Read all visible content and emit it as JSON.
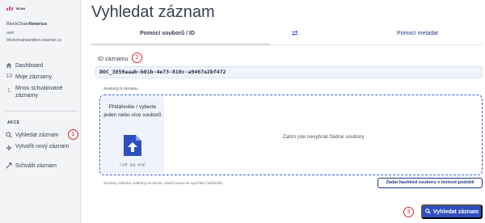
{
  "brand": {
    "logo_text": "BChN",
    "app_name_prefix": "BlockChain",
    "app_name_bold": "Notarius",
    "pink": "#ec4899"
  },
  "user": {
    "role": "uzel",
    "host": "blockchainsandbox.elachan.cz"
  },
  "sidebar": {
    "items": [
      {
        "icon": "home-icon",
        "prefix": "",
        "label": "Dashboard"
      },
      {
        "icon": "count",
        "prefix": "13",
        "label": "Moje záznamy"
      },
      {
        "icon": "count",
        "prefix": "1",
        "label": "Mnou schvalované záznamy"
      }
    ],
    "section_title": "AKCE",
    "actions": [
      {
        "icon": "search-icon",
        "label": "Vyhledat záznam",
        "marker": "1"
      },
      {
        "icon": "plus-icon",
        "label": "Vytvořit nový záznam"
      },
      {
        "icon": "hammer-icon",
        "label": "Schválit záznam"
      }
    ]
  },
  "main": {
    "title": "Vyhledat záznam",
    "tabs": [
      {
        "label": "Pomocí souborů / ID",
        "active": true
      },
      {
        "label": "Pomocí metadat",
        "active": false
      }
    ],
    "swap_icon": "⇄",
    "id_label": "ID záznamu",
    "id_marker": "2",
    "id_value": "DOC_3859aaab-b01b-4e73-810c-a9467e2bf472",
    "files_label": "Soubor(y) k záznamu",
    "drop_text": "Přetáhněte / vyberte jeden nebo více souborů",
    "drop_formats": "(.pdf, .jpg, .png)",
    "empty_message": "Zatím jste nevybrali žádné soubory",
    "note": "Soubory nebudou nahrány na server, slouží pouze ke spočítání hashkódů.",
    "hash_button": "Zadat hashkód souboru v textové podobě",
    "submit_marker": "3",
    "submit_button": "Vyhledat záznam",
    "accent": "#2f4fbf",
    "marker_color": "#dc2626"
  }
}
